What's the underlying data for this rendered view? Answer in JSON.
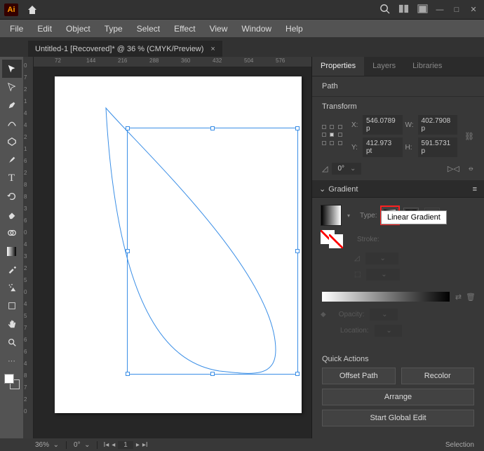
{
  "app_badge": "Ai",
  "menu": [
    "File",
    "Edit",
    "Object",
    "Type",
    "Select",
    "Effect",
    "View",
    "Window",
    "Help"
  ],
  "tab": {
    "title": "Untitled-1 [Recovered]* @ 36 % (CMYK/Preview)",
    "close": "×"
  },
  "rulerH": [
    "72",
    "144",
    "216",
    "288",
    "360",
    "432",
    "504",
    "576"
  ],
  "rulerV": [
    "0",
    "7",
    "2",
    "1",
    "4",
    "4",
    "2",
    "1",
    "6",
    "2",
    "8",
    "8",
    "3",
    "6",
    "0",
    "4",
    "3",
    "2",
    "5",
    "0",
    "4",
    "5",
    "7",
    "6",
    "6",
    "4",
    "8",
    "7",
    "2",
    "0"
  ],
  "panel_tabs": [
    "Properties",
    "Layers",
    "Libraries"
  ],
  "path_label": "Path",
  "transform": {
    "title": "Transform",
    "x_lab": "X:",
    "x": "546.0789 p",
    "w_lab": "W:",
    "w": "402.7908 p",
    "y_lab": "Y:",
    "y": "412.973 pt",
    "h_lab": "H:",
    "h": "591.5731 p",
    "rot": "0°"
  },
  "gradient": {
    "title": "Gradient",
    "type_label": "Type:",
    "stroke_label": "Stroke:",
    "tooltip": "Linear Gradient",
    "opacity_label": "Opacity:",
    "location_label": "Location:"
  },
  "qa": {
    "title": "Quick Actions",
    "offset": "Offset Path",
    "recolor": "Recolor",
    "arrange": "Arrange",
    "start": "Start Global Edit"
  },
  "status": {
    "zoom": "36%",
    "rot": "0°",
    "mode": "Selection"
  }
}
